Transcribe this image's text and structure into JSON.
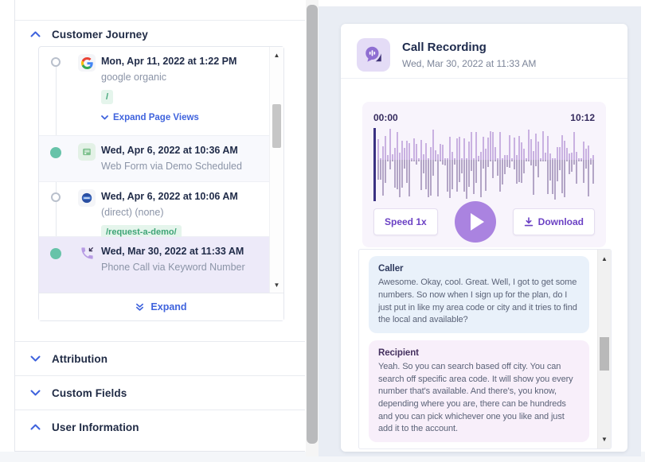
{
  "colors": {
    "accent_blue": "#3f63dd",
    "accent_purple": "#6b41c4",
    "play_button": "#aa83e0",
    "timeline_teal": "#67c3a9",
    "selected_row_bg": "#edeaf9",
    "tag_green": "#3fa477",
    "right_background": "#e9edf4",
    "player_bg": "#f8f4fc",
    "caller_bubble_bg": "#e9f1fa",
    "recipient_bubble_bg": "#f8effa"
  },
  "left_panel": {
    "sections": {
      "customer_journey": {
        "label": "Customer Journey",
        "state": "expanded"
      },
      "attribution": {
        "label": "Attribution",
        "state": "collapsed"
      },
      "custom_fields": {
        "label": "Custom Fields",
        "state": "collapsed"
      },
      "user_information": {
        "label": "User Information",
        "state": "expanded"
      }
    },
    "journey": {
      "events": [
        {
          "icon": "google-logo",
          "marker": "hollow",
          "date": "Mon, Apr 11, 2022 at 1:22 PM",
          "subtitle": "google organic",
          "tag": "/",
          "expand_link": "Expand Page Views"
        },
        {
          "icon": "web-form-icon",
          "marker": "filled",
          "date": "Wed, Apr 6, 2022 at 10:36 AM",
          "subtitle": "Web Form via Demo Scheduled"
        },
        {
          "icon": "direct-visit-icon",
          "marker": "hollow",
          "date": "Wed, Apr 6, 2022 at 10:06 AM",
          "subtitle": "(direct) (none)",
          "tag": "/request-a-demo/"
        },
        {
          "icon": "phone-call-icon",
          "marker": "filled",
          "date": "Wed, Mar 30, 2022 at 11:33 AM",
          "subtitle": "Phone Call via Keyword Number",
          "selected": true
        }
      ],
      "expand_label": "Expand"
    }
  },
  "call_recording": {
    "title": "Call Recording",
    "datetime": "Wed, Mar 30, 2022 at 11:33 AM",
    "player": {
      "current_time": "00:00",
      "total_time": "10:12",
      "speed_label": "Speed 1x",
      "download_label": "Download"
    },
    "transcript": [
      {
        "speaker": "Caller",
        "text": "Awesome. Okay, cool. Great. Well, I got to get some numbers. So now when I sign up for the plan, do I just put in like my area code or city and it tries to find the local and available?"
      },
      {
        "speaker": "Recipient",
        "text": "Yeah. So you can search based off city. You can search off specific area code. It will show you every number that's available. And there's, you know, depending where you are, there can be hundreds and you can pick whichever one you like and just add it to the account."
      }
    ]
  }
}
